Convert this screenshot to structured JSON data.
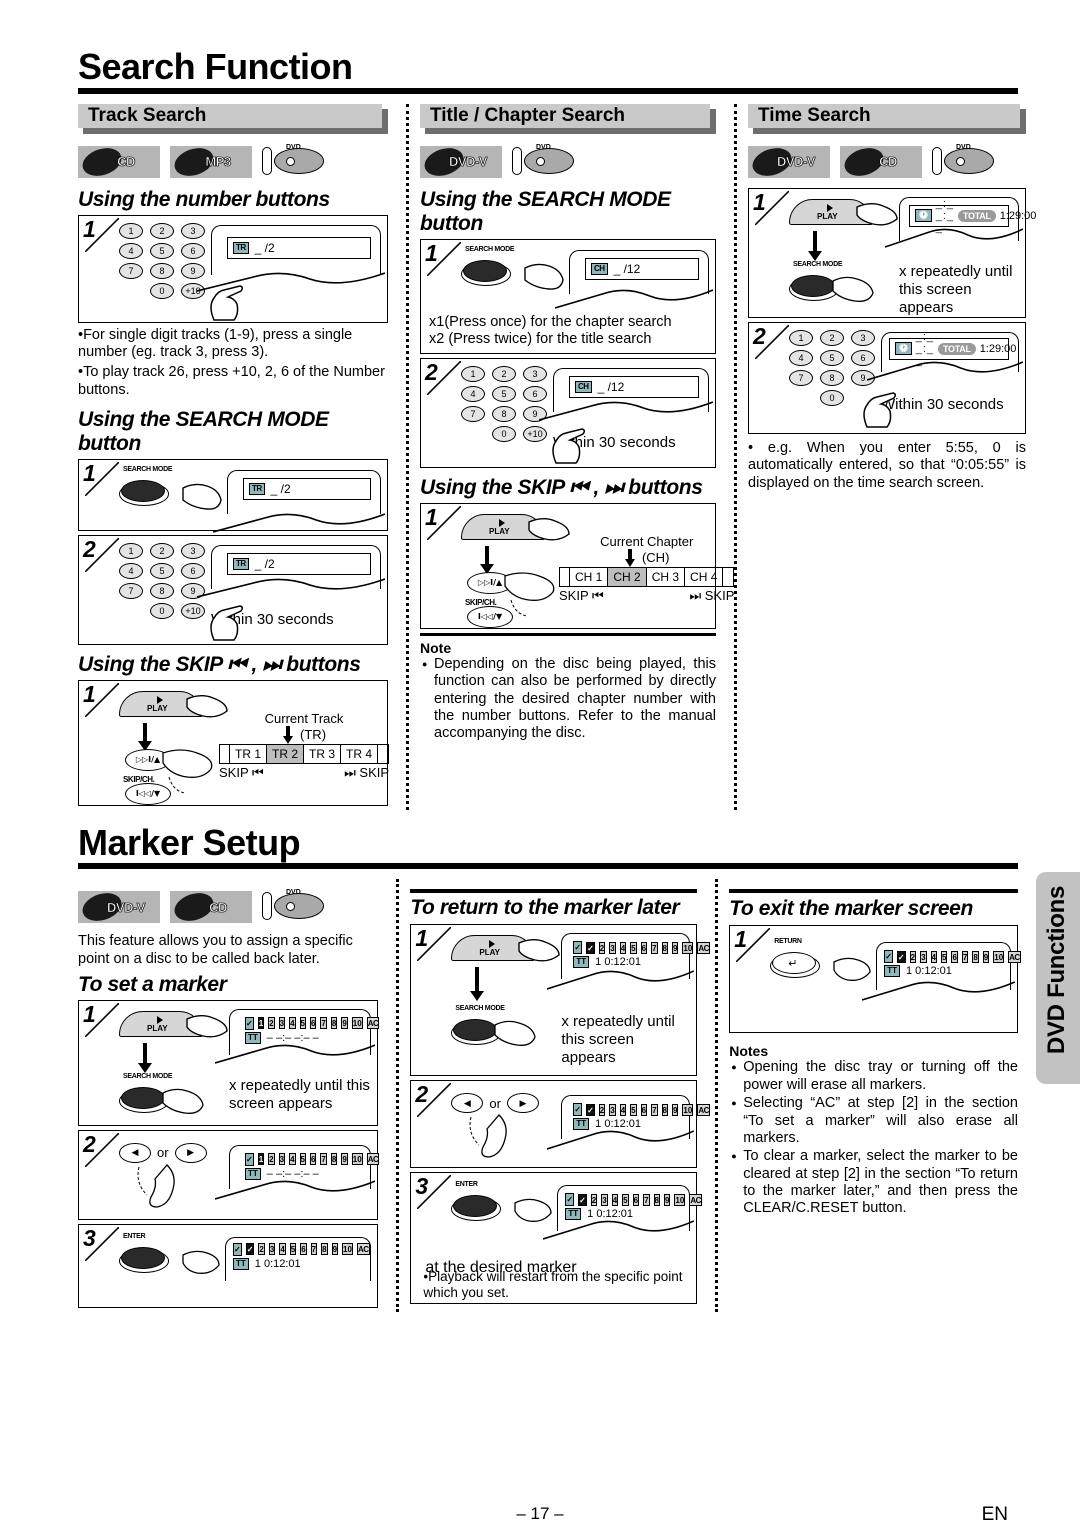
{
  "page": {
    "number": "– 17 –",
    "lang": "EN",
    "side_tab": "DVD Functions"
  },
  "sections": [
    {
      "id": "search",
      "title": "Search Function"
    },
    {
      "id": "marker",
      "title": "Marker Setup"
    }
  ],
  "track_search": {
    "band": "Track Search",
    "badges": [
      "CD",
      "MP3"
    ],
    "disc_icon": "dvd-disc-tray-icon",
    "sub1": "Using the number buttons",
    "step1_display": {
      "tag": "TR",
      "value": "_ /2"
    },
    "bullets": [
      "For single digit tracks (1-9), press a single number (eg. track 3, press 3).",
      "To play track 26, press +10, 2, 6 of the Number buttons."
    ],
    "sub2": "Using the SEARCH MODE button",
    "sm_step1_button": "SEARCH MODE",
    "sm_step1_display": {
      "tag": "TR",
      "value": "_ /2"
    },
    "sm_step2_display": {
      "tag": "TR",
      "value": "_ /2"
    },
    "sm_step2_note": "Within 30 seconds",
    "sub3": "Using the SKIP ⏮ , ⏭ buttons",
    "skip_play_label": "PLAY",
    "skip_jog_label": "SKIP/CH.",
    "skip_current_label": "Current Track",
    "skip_current_unit": "(TR)",
    "skip_cells": [
      "TR 1",
      "TR 2",
      "TR 3",
      "TR 4"
    ],
    "skip_current_index": 1,
    "skip_left": "SKIP ⏮",
    "skip_right": "⏭ SKIP"
  },
  "title_chapter_search": {
    "band": "Title / Chapter Search",
    "badges": [
      "DVD-V"
    ],
    "sub1": "Using the SEARCH MODE button",
    "step1_button": "SEARCH MODE",
    "step1_display": {
      "tag": "CH",
      "value": "_ /12"
    },
    "press_lines": [
      "x1(Press once) for the chapter search",
      "x2 (Press twice) for the title search"
    ],
    "step2_display": {
      "tag": "CH",
      "value": "_ /12"
    },
    "step2_note": "Within 30 seconds",
    "sub2": "Using the SKIP ⏮ , ⏭ buttons",
    "skip_play_label": "PLAY",
    "skip_jog_label": "SKIP/CH.",
    "skip_current_label": "Current Chapter",
    "skip_current_unit": "(CH)",
    "skip_cells": [
      "CH 1",
      "CH 2",
      "CH 3",
      "CH 4"
    ],
    "skip_current_index": 1,
    "skip_left": "SKIP ⏮",
    "skip_right": "⏭ SKIP",
    "note_heading": "Note",
    "note_items": [
      "Depending on the disc being played, this function can also be performed by directly entering the desired chapter number with the number buttons. Refer to the manual accompanying the disc."
    ]
  },
  "time_search": {
    "band": "Time Search",
    "badges": [
      "DVD-V",
      "CD"
    ],
    "step1_play_label": "PLAY",
    "step1_button": "SEARCH MODE",
    "step1_display": {
      "icon": "clock-icon",
      "value": "_:_ _:_ _",
      "pill": "TOTAL",
      "time": "1:29:00"
    },
    "step1_note": "x repeatedly until this screen appears",
    "step2_display": {
      "icon": "clock-icon",
      "value": "_:_ _:_ _",
      "pill": "TOTAL",
      "time": "1:29:00"
    },
    "step2_note": "Within 30 seconds",
    "bullets": [
      "e.g. When you enter 5:55, 0 is automatically entered, so that “0:05:55” is displayed on the time search screen."
    ]
  },
  "marker_set": {
    "badges": [
      "DVD-V",
      "CD"
    ],
    "intro": "This feature allows you to assign a specific point on a disc to be called back later.",
    "sub1": "To set a marker",
    "step1_play_label": "PLAY",
    "step1_button": "SEARCH MODE",
    "step1_osd": {
      "markers": [
        "1",
        "2",
        "3",
        "4",
        "5",
        "6",
        "7",
        "8",
        "9",
        "10"
      ],
      "ac": "AC",
      "selected": 0,
      "checked": [],
      "tag": "TT",
      "time": "– –:– –:– –"
    },
    "step1_note": "x repeatedly until this screen appears",
    "step2_or": "or",
    "step2_osd": {
      "markers": [
        "1",
        "2",
        "3",
        "4",
        "5",
        "6",
        "7",
        "8",
        "9",
        "10"
      ],
      "ac": "AC",
      "selected": 0,
      "checked": [],
      "tag": "TT",
      "time": "– –:– –:– –"
    },
    "step3_button": "ENTER",
    "step3_osd": {
      "markers": [
        "1",
        "2",
        "3",
        "4",
        "5",
        "6",
        "7",
        "8",
        "9",
        "10"
      ],
      "ac": "AC",
      "selected": 0,
      "checked": [
        0
      ],
      "tag": "TT",
      "time": "1  0:12:01"
    }
  },
  "marker_return": {
    "sub1": "To return to the marker later",
    "step1_play_label": "PLAY",
    "step1_button": "SEARCH MODE",
    "step1_osd": {
      "markers": [
        "1",
        "2",
        "3",
        "4",
        "5",
        "6",
        "7",
        "8",
        "9",
        "10"
      ],
      "ac": "AC",
      "selected": 0,
      "checked": [
        0
      ],
      "tag": "TT",
      "time": "1  0:12:01"
    },
    "step1_note": "x repeatedly until this screen appears",
    "step2_or": "or",
    "step2_osd": {
      "markers": [
        "1",
        "2",
        "3",
        "4",
        "5",
        "6",
        "7",
        "8",
        "9",
        "10"
      ],
      "ac": "AC",
      "selected": 0,
      "checked": [
        0
      ],
      "tag": "TT",
      "time": "1  0:12:01"
    },
    "step3_button": "ENTER",
    "step3_osd": {
      "markers": [
        "1",
        "2",
        "3",
        "4",
        "5",
        "6",
        "7",
        "8",
        "9",
        "10"
      ],
      "ac": "AC",
      "selected": 0,
      "checked": [
        0
      ],
      "tag": "TT",
      "time": "1  0:12:01"
    },
    "step3_caption": "at the desired marker",
    "step3_bullet": "Playback will restart from the specific point which you set."
  },
  "marker_exit": {
    "sub1": "To exit the marker screen",
    "step1_button": "RETURN",
    "step1_osd": {
      "markers": [
        "1",
        "2",
        "3",
        "4",
        "5",
        "6",
        "7",
        "8",
        "9",
        "10"
      ],
      "ac": "AC",
      "selected": 0,
      "checked": [
        0
      ],
      "tag": "TT",
      "time": "1  0:12:01"
    },
    "notes_heading": "Notes",
    "notes": [
      "Opening the disc tray or turning off the power will erase all markers.",
      "Selecting “AC” at step [2] in the section “To set a marker” will also erase all markers.",
      "To clear a marker, select the marker to be cleared at step [2] in the section “To return to the marker later,”  and then press the CLEAR/C.RESET button."
    ]
  },
  "keypad": {
    "rows": [
      [
        "1",
        "2",
        "3"
      ],
      [
        "4",
        "5",
        "6"
      ],
      [
        "7",
        "8",
        "9"
      ],
      [
        "0",
        "+10"
      ]
    ]
  },
  "colors": {
    "band_bg": "#c9c9c9",
    "band_shadow": "#6d6d6d",
    "badge_bg": "#b5b5b5",
    "osd_tag": "#8fb8bd",
    "marker_off": "#cfcfcf",
    "marker_on": "#111111",
    "current_cell": "#bdbdbd",
    "tab_bg": "#c2c2c2"
  }
}
